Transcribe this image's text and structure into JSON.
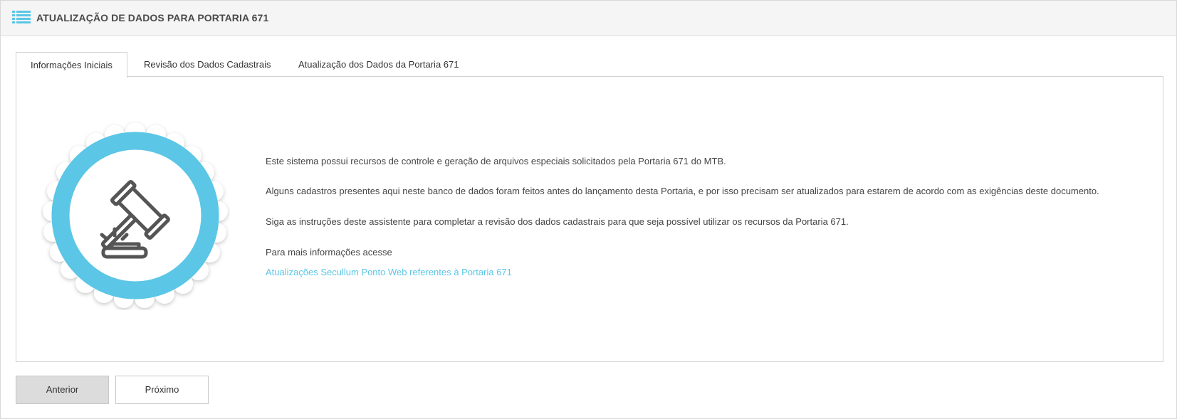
{
  "header": {
    "title": "ATUALIZAÇÃO DE DADOS PARA PORTARIA 671",
    "icon": "list-icon",
    "icon_color": "#5bc6e6"
  },
  "tabs": [
    {
      "label": "Informações Iniciais",
      "active": true
    },
    {
      "label": "Revisão dos Dados Cadastrais",
      "active": false
    },
    {
      "label": "Atualização dos Dados da Portaria 671",
      "active": false
    }
  ],
  "content": {
    "emblem_icon": "gavel-icon",
    "paragraphs": [
      "Este sistema possui recursos de controle e geração de arquivos especiais solicitados pela Portaria 671 do MTB.",
      "Alguns cadastros presentes aqui neste banco de dados foram feitos antes do lançamento desta Portaria, e por isso precisam ser atualizados para estarem de acordo com as exigências deste documento.",
      "Siga as instruções deste assistente para completar a revisão dos dados cadastrais para que seja possível utilizar os recursos da Portaria 671.",
      "Para mais informações acesse"
    ],
    "link_text": "Atualizações Secullum Ponto Web referentes à Portaria 671",
    "link_color": "#5bc6e6",
    "accent_color": "#5bc6e6"
  },
  "footer": {
    "prev_label": "Anterior",
    "next_label": "Próximo"
  }
}
